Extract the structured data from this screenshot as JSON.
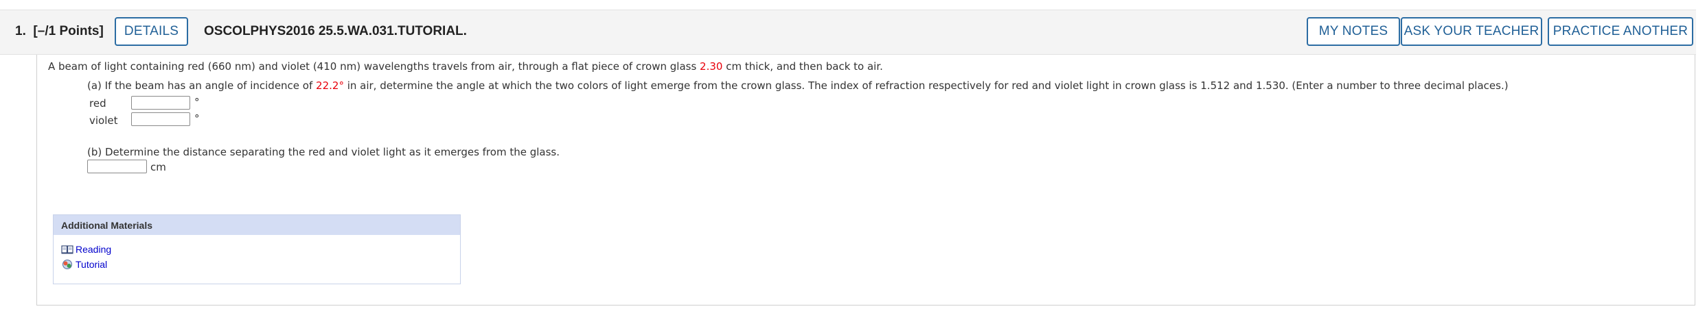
{
  "header": {
    "question_number": "1.",
    "points": "[–/1 Points]",
    "details_label": "DETAILS",
    "title": "OSCOLPHYS2016 25.5.WA.031.TUTORIAL.",
    "my_notes_label": "MY NOTES",
    "ask_teacher_label": "ASK YOUR TEACHER",
    "practice_another_label": "PRACTICE ANOTHER"
  },
  "question": {
    "intro_part1": "A beam of light containing red (660 nm) and violet (410 nm) wavelengths travels from air, through a flat piece of crown glass ",
    "thickness": "2.30",
    "intro_part2": " cm thick, and then back to air.",
    "part_a_prefix": "(a) If the beam has an angle of incidence of ",
    "angle": "22.2",
    "angle_unit": "°",
    "part_a_suffix": " in air, determine the angle at which the two colors of light emerge from the crown glass. The index of refraction respectively for red and violet light in crown glass is 1.512 and 1.530. (Enter a number to three decimal places.)",
    "red_label": "red",
    "red_value": "",
    "red_unit": "°",
    "violet_label": "violet",
    "violet_value": "",
    "violet_unit": "°",
    "part_b": "(b) Determine the distance separating the red and violet light as it emerges from the glass.",
    "distance_value": "",
    "distance_unit": "cm"
  },
  "materials": {
    "heading": "Additional Materials",
    "items": [
      {
        "label": "Reading",
        "icon": "book-icon"
      },
      {
        "label": "Tutorial",
        "icon": "tutorial-icon"
      }
    ]
  },
  "colors": {
    "accent_blue": "#2b6ca3",
    "highlight_red": "#e8000b",
    "link_blue": "#0000cc",
    "materials_header": "#d4ddf4"
  }
}
